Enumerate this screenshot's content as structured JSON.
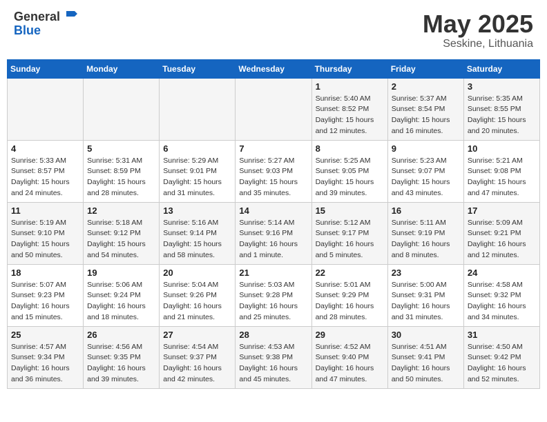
{
  "header": {
    "logo_general": "General",
    "logo_blue": "Blue",
    "month_title": "May 2025",
    "location": "Seskine, Lithuania"
  },
  "days_of_week": [
    "Sunday",
    "Monday",
    "Tuesday",
    "Wednesday",
    "Thursday",
    "Friday",
    "Saturday"
  ],
  "weeks": [
    [
      {
        "day": "",
        "info": ""
      },
      {
        "day": "",
        "info": ""
      },
      {
        "day": "",
        "info": ""
      },
      {
        "day": "",
        "info": ""
      },
      {
        "day": "1",
        "info": "Sunrise: 5:40 AM\nSunset: 8:52 PM\nDaylight: 15 hours\nand 12 minutes."
      },
      {
        "day": "2",
        "info": "Sunrise: 5:37 AM\nSunset: 8:54 PM\nDaylight: 15 hours\nand 16 minutes."
      },
      {
        "day": "3",
        "info": "Sunrise: 5:35 AM\nSunset: 8:55 PM\nDaylight: 15 hours\nand 20 minutes."
      }
    ],
    [
      {
        "day": "4",
        "info": "Sunrise: 5:33 AM\nSunset: 8:57 PM\nDaylight: 15 hours\nand 24 minutes."
      },
      {
        "day": "5",
        "info": "Sunrise: 5:31 AM\nSunset: 8:59 PM\nDaylight: 15 hours\nand 28 minutes."
      },
      {
        "day": "6",
        "info": "Sunrise: 5:29 AM\nSunset: 9:01 PM\nDaylight: 15 hours\nand 31 minutes."
      },
      {
        "day": "7",
        "info": "Sunrise: 5:27 AM\nSunset: 9:03 PM\nDaylight: 15 hours\nand 35 minutes."
      },
      {
        "day": "8",
        "info": "Sunrise: 5:25 AM\nSunset: 9:05 PM\nDaylight: 15 hours\nand 39 minutes."
      },
      {
        "day": "9",
        "info": "Sunrise: 5:23 AM\nSunset: 9:07 PM\nDaylight: 15 hours\nand 43 minutes."
      },
      {
        "day": "10",
        "info": "Sunrise: 5:21 AM\nSunset: 9:08 PM\nDaylight: 15 hours\nand 47 minutes."
      }
    ],
    [
      {
        "day": "11",
        "info": "Sunrise: 5:19 AM\nSunset: 9:10 PM\nDaylight: 15 hours\nand 50 minutes."
      },
      {
        "day": "12",
        "info": "Sunrise: 5:18 AM\nSunset: 9:12 PM\nDaylight: 15 hours\nand 54 minutes."
      },
      {
        "day": "13",
        "info": "Sunrise: 5:16 AM\nSunset: 9:14 PM\nDaylight: 15 hours\nand 58 minutes."
      },
      {
        "day": "14",
        "info": "Sunrise: 5:14 AM\nSunset: 9:16 PM\nDaylight: 16 hours\nand 1 minute."
      },
      {
        "day": "15",
        "info": "Sunrise: 5:12 AM\nSunset: 9:17 PM\nDaylight: 16 hours\nand 5 minutes."
      },
      {
        "day": "16",
        "info": "Sunrise: 5:11 AM\nSunset: 9:19 PM\nDaylight: 16 hours\nand 8 minutes."
      },
      {
        "day": "17",
        "info": "Sunrise: 5:09 AM\nSunset: 9:21 PM\nDaylight: 16 hours\nand 12 minutes."
      }
    ],
    [
      {
        "day": "18",
        "info": "Sunrise: 5:07 AM\nSunset: 9:23 PM\nDaylight: 16 hours\nand 15 minutes."
      },
      {
        "day": "19",
        "info": "Sunrise: 5:06 AM\nSunset: 9:24 PM\nDaylight: 16 hours\nand 18 minutes."
      },
      {
        "day": "20",
        "info": "Sunrise: 5:04 AM\nSunset: 9:26 PM\nDaylight: 16 hours\nand 21 minutes."
      },
      {
        "day": "21",
        "info": "Sunrise: 5:03 AM\nSunset: 9:28 PM\nDaylight: 16 hours\nand 25 minutes."
      },
      {
        "day": "22",
        "info": "Sunrise: 5:01 AM\nSunset: 9:29 PM\nDaylight: 16 hours\nand 28 minutes."
      },
      {
        "day": "23",
        "info": "Sunrise: 5:00 AM\nSunset: 9:31 PM\nDaylight: 16 hours\nand 31 minutes."
      },
      {
        "day": "24",
        "info": "Sunrise: 4:58 AM\nSunset: 9:32 PM\nDaylight: 16 hours\nand 34 minutes."
      }
    ],
    [
      {
        "day": "25",
        "info": "Sunrise: 4:57 AM\nSunset: 9:34 PM\nDaylight: 16 hours\nand 36 minutes."
      },
      {
        "day": "26",
        "info": "Sunrise: 4:56 AM\nSunset: 9:35 PM\nDaylight: 16 hours\nand 39 minutes."
      },
      {
        "day": "27",
        "info": "Sunrise: 4:54 AM\nSunset: 9:37 PM\nDaylight: 16 hours\nand 42 minutes."
      },
      {
        "day": "28",
        "info": "Sunrise: 4:53 AM\nSunset: 9:38 PM\nDaylight: 16 hours\nand 45 minutes."
      },
      {
        "day": "29",
        "info": "Sunrise: 4:52 AM\nSunset: 9:40 PM\nDaylight: 16 hours\nand 47 minutes."
      },
      {
        "day": "30",
        "info": "Sunrise: 4:51 AM\nSunset: 9:41 PM\nDaylight: 16 hours\nand 50 minutes."
      },
      {
        "day": "31",
        "info": "Sunrise: 4:50 AM\nSunset: 9:42 PM\nDaylight: 16 hours\nand 52 minutes."
      }
    ]
  ]
}
